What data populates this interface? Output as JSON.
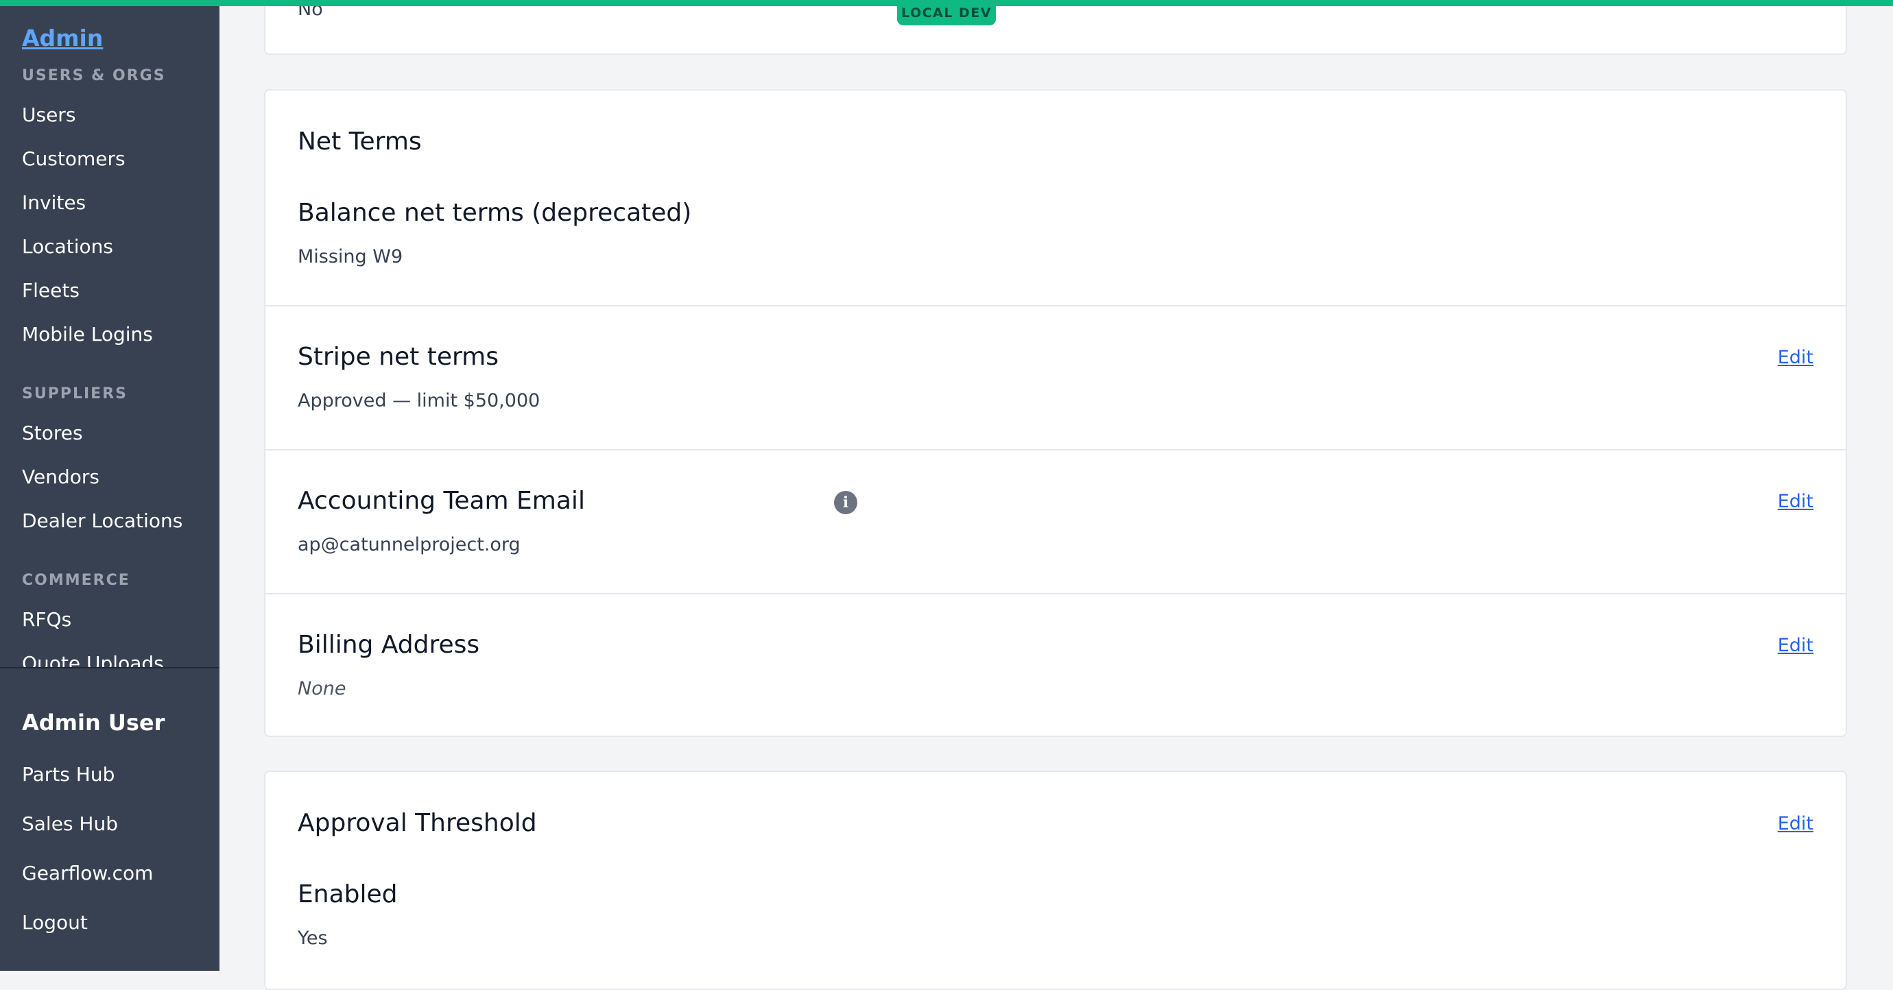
{
  "env_badge": "LOCAL DEV",
  "sidebar": {
    "brand": "Admin",
    "sections": [
      {
        "title": "USERS & ORGS",
        "items": [
          "Users",
          "Customers",
          "Invites",
          "Locations",
          "Fleets",
          "Mobile Logins"
        ]
      },
      {
        "title": "SUPPLIERS",
        "items": [
          "Stores",
          "Vendors",
          "Dealer Locations"
        ]
      },
      {
        "title": "COMMERCE",
        "items": [
          "RFQs",
          "Quote Uploads"
        ]
      }
    ],
    "user": {
      "name": "Admin User",
      "links": [
        "Parts Hub",
        "Sales Hub",
        "Gearflow.com",
        "Logout"
      ]
    }
  },
  "main": {
    "top_card_value": "No",
    "net_terms": {
      "title": "Net Terms",
      "balance": {
        "label": "Balance net terms (deprecated)",
        "value": "Missing W9"
      },
      "stripe": {
        "label": "Stripe net terms",
        "value": "Approved — limit $50,000",
        "edit": "Edit"
      },
      "accounting_email": {
        "label": "Accounting Team Email",
        "value": "ap@catunnelproject.org",
        "edit": "Edit",
        "info_icon": "i"
      },
      "billing_address": {
        "label": "Billing Address",
        "value": "None",
        "edit": "Edit"
      }
    },
    "approval": {
      "title": "Approval Threshold",
      "edit": "Edit",
      "enabled_label": "Enabled",
      "enabled_value": "Yes"
    }
  },
  "colors": {
    "accent": "#10b981",
    "sidebar_bg": "#374151",
    "link": "#2563eb",
    "page_bg": "#f3f4f6"
  }
}
